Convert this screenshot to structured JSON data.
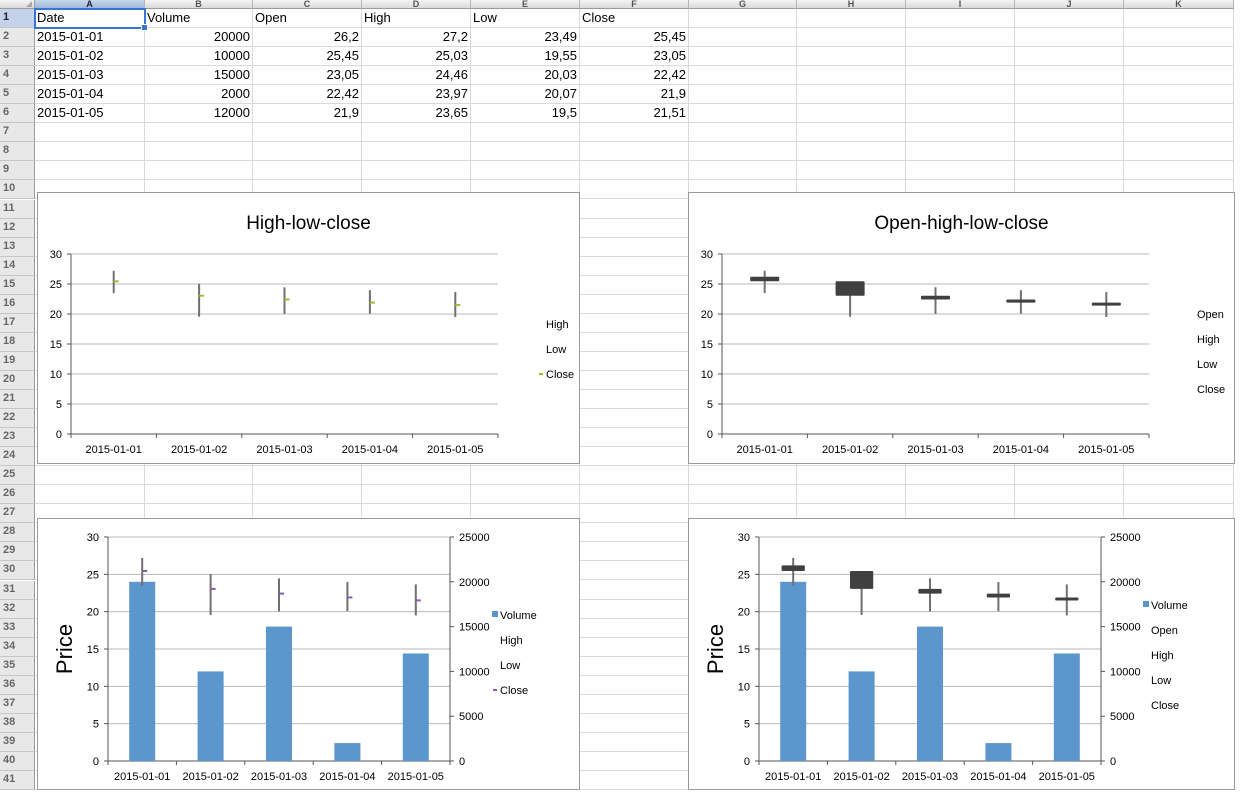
{
  "spreadsheet": {
    "columns": [
      "A",
      "B",
      "C",
      "D",
      "E",
      "F",
      "G",
      "H",
      "I",
      "J",
      "K"
    ],
    "rows": [
      1,
      2,
      3,
      4,
      5,
      6,
      7,
      8,
      9,
      10,
      11,
      12,
      13,
      14,
      15,
      16,
      17,
      18,
      19,
      20,
      21,
      22,
      23,
      24,
      25,
      26,
      27,
      28,
      29,
      30,
      31,
      32,
      33,
      34,
      35,
      36,
      37,
      38,
      39,
      40,
      41
    ],
    "header": [
      "Date",
      "Volume",
      "Open",
      "High",
      "Low",
      "Close"
    ],
    "data": [
      [
        "2015-01-01",
        "20000",
        "26,2",
        "27,2",
        "23,49",
        "25,45"
      ],
      [
        "2015-01-02",
        "10000",
        "25,45",
        "25,03",
        "19,55",
        "23,05"
      ],
      [
        "2015-01-03",
        "15000",
        "23,05",
        "24,46",
        "20,03",
        "22,42"
      ],
      [
        "2015-01-04",
        "2000",
        "22,42",
        "23,97",
        "20,07",
        "21,9"
      ],
      [
        "2015-01-05",
        "12000",
        "21,9",
        "23,65",
        "19,5",
        "21,51"
      ]
    ],
    "active_cell": "A1"
  },
  "chart_data": [
    {
      "type": "stock-hlc",
      "title": "High-low-close",
      "categories": [
        "2015-01-01",
        "2015-01-02",
        "2015-01-03",
        "2015-01-04",
        "2015-01-05"
      ],
      "series": [
        {
          "name": "High",
          "values": [
            27.2,
            25.03,
            24.46,
            23.97,
            23.65
          ]
        },
        {
          "name": "Low",
          "values": [
            23.49,
            19.55,
            20.03,
            20.07,
            19.5
          ]
        },
        {
          "name": "Close",
          "values": [
            25.45,
            23.05,
            22.42,
            21.9,
            21.51
          ]
        }
      ],
      "ylim": [
        0,
        30
      ],
      "yticks": [
        0,
        5,
        10,
        15,
        20,
        25,
        30
      ],
      "legend": [
        "High",
        "Low",
        "Close"
      ],
      "legend_position": "right",
      "grid": true
    },
    {
      "type": "stock-ohlc",
      "title": "Open-high-low-close",
      "categories": [
        "2015-01-01",
        "2015-01-02",
        "2015-01-03",
        "2015-01-04",
        "2015-01-05"
      ],
      "series": [
        {
          "name": "Open",
          "values": [
            26.2,
            25.45,
            23.05,
            22.42,
            21.9
          ]
        },
        {
          "name": "High",
          "values": [
            27.2,
            25.03,
            24.46,
            23.97,
            23.65
          ]
        },
        {
          "name": "Low",
          "values": [
            23.49,
            19.55,
            20.03,
            20.07,
            19.5
          ]
        },
        {
          "name": "Close",
          "values": [
            25.45,
            23.05,
            22.42,
            21.9,
            21.51
          ]
        }
      ],
      "ylim": [
        0,
        30
      ],
      "yticks": [
        0,
        5,
        10,
        15,
        20,
        25,
        30
      ],
      "legend": [
        "Open",
        "High",
        "Low",
        "Close"
      ],
      "legend_position": "right",
      "grid": true
    },
    {
      "type": "stock-vhlc",
      "title": "",
      "ylabel": "Price",
      "categories": [
        "2015-01-01",
        "2015-01-02",
        "2015-01-03",
        "2015-01-04",
        "2015-01-05"
      ],
      "series": [
        {
          "name": "Volume",
          "values": [
            20000,
            10000,
            15000,
            2000,
            12000
          ],
          "color": "#5b96cc"
        },
        {
          "name": "High",
          "values": [
            27.2,
            25.03,
            24.46,
            23.97,
            23.65
          ]
        },
        {
          "name": "Low",
          "values": [
            23.49,
            19.55,
            20.03,
            20.07,
            19.5
          ]
        },
        {
          "name": "Close",
          "values": [
            25.45,
            23.05,
            22.42,
            21.9,
            21.51
          ]
        }
      ],
      "ylim": [
        0,
        30
      ],
      "yticks": [
        0,
        5,
        10,
        15,
        20,
        25,
        30
      ],
      "y2lim": [
        0,
        25000
      ],
      "y2ticks": [
        0,
        5000,
        10000,
        15000,
        20000,
        25000
      ],
      "legend": [
        "Volume",
        "High",
        "Low",
        "Close"
      ],
      "legend_position": "right",
      "grid": true
    },
    {
      "type": "stock-vohlc",
      "title": "",
      "ylabel": "Price",
      "categories": [
        "2015-01-01",
        "2015-01-02",
        "2015-01-03",
        "2015-01-04",
        "2015-01-05"
      ],
      "series": [
        {
          "name": "Volume",
          "values": [
            20000,
            10000,
            15000,
            2000,
            12000
          ],
          "color": "#5b96cc"
        },
        {
          "name": "Open",
          "values": [
            26.2,
            25.45,
            23.05,
            22.42,
            21.9
          ]
        },
        {
          "name": "High",
          "values": [
            27.2,
            25.03,
            24.46,
            23.97,
            23.65
          ]
        },
        {
          "name": "Low",
          "values": [
            23.49,
            19.55,
            20.03,
            20.07,
            19.5
          ]
        },
        {
          "name": "Close",
          "values": [
            25.45,
            23.05,
            22.42,
            21.9,
            21.51
          ]
        }
      ],
      "ylim": [
        0,
        30
      ],
      "yticks": [
        0,
        5,
        10,
        15,
        20,
        25,
        30
      ],
      "y2lim": [
        0,
        25000
      ],
      "y2ticks": [
        0,
        5000,
        10000,
        15000,
        20000,
        25000
      ],
      "legend": [
        "Volume",
        "Open",
        "High",
        "Low",
        "Close"
      ],
      "legend_position": "right",
      "grid": true
    }
  ],
  "colors": {
    "volume": "#5b96cc",
    "candle": "#404040",
    "wick": "#707070",
    "close_marker_hlc": "#a9b82c",
    "close_marker_vhlc": "#8a5bb0",
    "grid": "#b8b8b8"
  }
}
